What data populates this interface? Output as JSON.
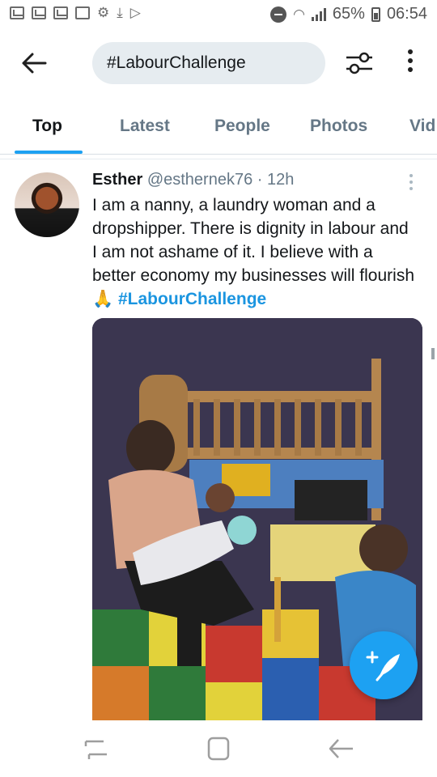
{
  "status_bar": {
    "battery": "65%",
    "time": "06:54",
    "notification_icons": [
      "mail-icon",
      "mail-icon",
      "mail-icon",
      "image-icon",
      "settings-icon",
      "download-icon",
      "play-store-icon"
    ]
  },
  "search": {
    "query": "#LabourChallenge"
  },
  "tabs": [
    {
      "label": "Top",
      "active": true
    },
    {
      "label": "Latest",
      "active": false
    },
    {
      "label": "People",
      "active": false
    },
    {
      "label": "Photos",
      "active": false
    },
    {
      "label": "Vid",
      "active": false
    }
  ],
  "tweet": {
    "name": "Esther",
    "handle": "@esthernek76",
    "separator": "·",
    "time": "12h",
    "text": "I am a nanny, a laundry woman and a dropshipper. There is dignity in labour and I am not ashame of it. I believe with a better economy my businesses will flourish",
    "emoji": "🙏",
    "hashtag": "#LabourChallenge"
  },
  "colors": {
    "accent": "#1da1f2",
    "hashtag": "#1b95e0",
    "search_bg": "#e6ecf0",
    "muted_text": "#657786"
  }
}
